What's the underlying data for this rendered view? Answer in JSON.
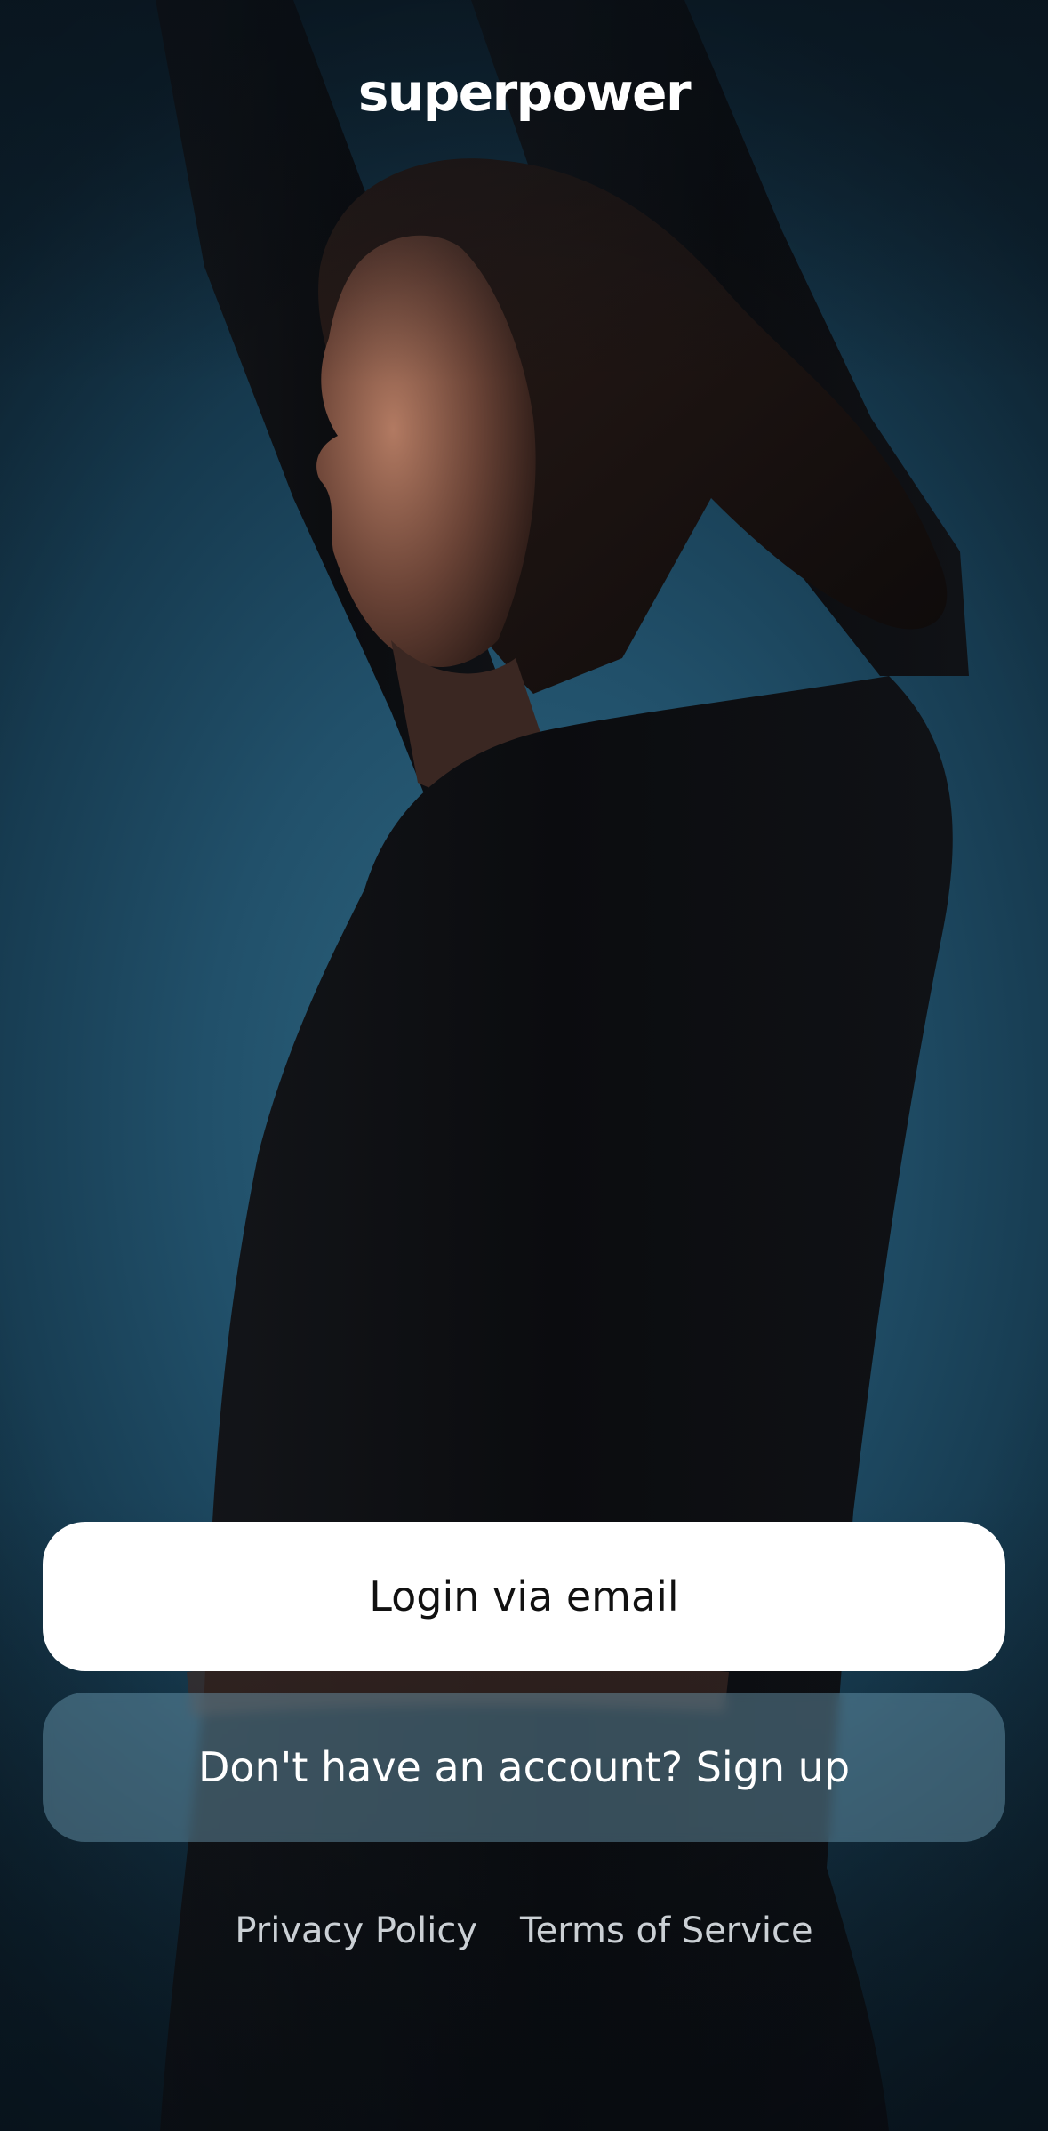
{
  "app": {
    "logo_text": "superpower"
  },
  "actions": {
    "login_label": "Login via email",
    "signup_label": "Don't have an account? Sign up"
  },
  "footer": {
    "privacy_label": "Privacy Policy",
    "terms_label": "Terms of Service"
  },
  "colors": {
    "background_accent": "#2f6781",
    "primary_button_bg": "#ffffff",
    "primary_button_text": "#111111",
    "secondary_button_bg": "#76aac2",
    "text_light": "#ffffff"
  },
  "background": {
    "image": "photo-woman-stretching-arms-raised"
  }
}
